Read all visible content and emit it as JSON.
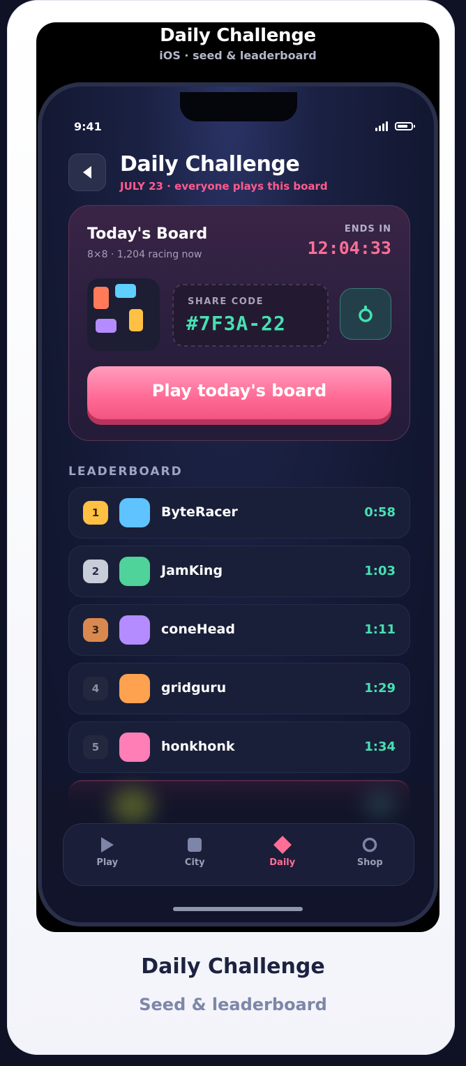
{
  "frame": {
    "title": "Daily Challenge",
    "subtitle": "iOS · seed & leaderboard"
  },
  "status_bar": {
    "time": "9:41",
    "icons": [
      "signal-icon",
      "battery-icon"
    ]
  },
  "header": {
    "title": "Daily Challenge",
    "subtitle": "JULY 23 · everyone plays this board",
    "back_icon": "chevron-left-icon"
  },
  "board": {
    "title": "Today's Board",
    "meta": "8×8 · 1,204 racing now",
    "ends_label": "ENDS IN",
    "ends_time": "12:04:33",
    "share_label": "SHARE CODE",
    "share_code": "#7F3A-22",
    "copy_icon": "share-ring-icon",
    "play_label": "Play today's board",
    "thumb_colors": [
      "#ff7a59",
      "#5ecfff",
      "#b48cff",
      "#ffc043"
    ]
  },
  "leaderboard": {
    "title": "LEADERBOARD",
    "rows": [
      {
        "rank": "1",
        "name": "ByteRacer",
        "time": "0:58"
      },
      {
        "rank": "2",
        "name": "JamKing",
        "time": "1:03"
      },
      {
        "rank": "3",
        "name": "coneHead",
        "time": "1:11"
      },
      {
        "rank": "4",
        "name": "gridguru",
        "time": "1:29"
      },
      {
        "rank": "5",
        "name": "honkhonk",
        "time": "1:34"
      }
    ]
  },
  "tabbar": {
    "tabs": [
      {
        "label": "Play",
        "icon": "play-icon"
      },
      {
        "label": "City",
        "icon": "city-icon"
      },
      {
        "label": "Daily",
        "icon": "diamond-icon"
      },
      {
        "label": "Shop",
        "icon": "shop-icon"
      }
    ],
    "active": "Daily"
  },
  "footer": {
    "title": "Daily Challenge",
    "subtitle": "Seed & leaderboard"
  },
  "colors": {
    "accent_pink": "#ff6e96",
    "accent_teal": "#46e0b2",
    "background": "#131833"
  }
}
